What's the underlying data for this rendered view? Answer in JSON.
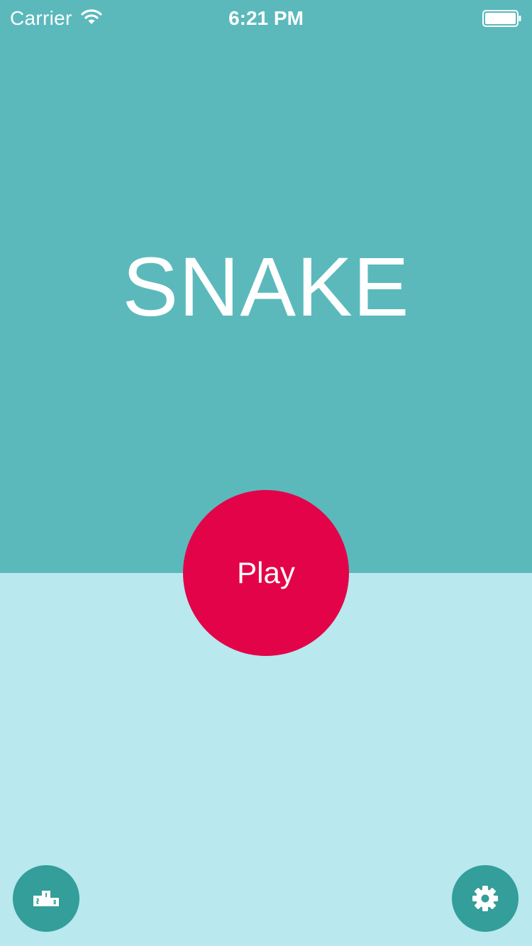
{
  "status_bar": {
    "carrier": "Carrier",
    "time": "6:21 PM",
    "icons": [
      "wifi-icon",
      "battery-icon"
    ]
  },
  "app": {
    "title": "SNAKE",
    "play_label": "Play"
  },
  "bottom_buttons": {
    "leaderboard_icon": "podium-icon",
    "settings_icon": "gear-icon"
  },
  "colors": {
    "top_background": "#5bb9bc",
    "bottom_background": "#b9e8ef",
    "play_button": "#e30349",
    "round_button": "#339e9a",
    "text": "#ffffff"
  }
}
